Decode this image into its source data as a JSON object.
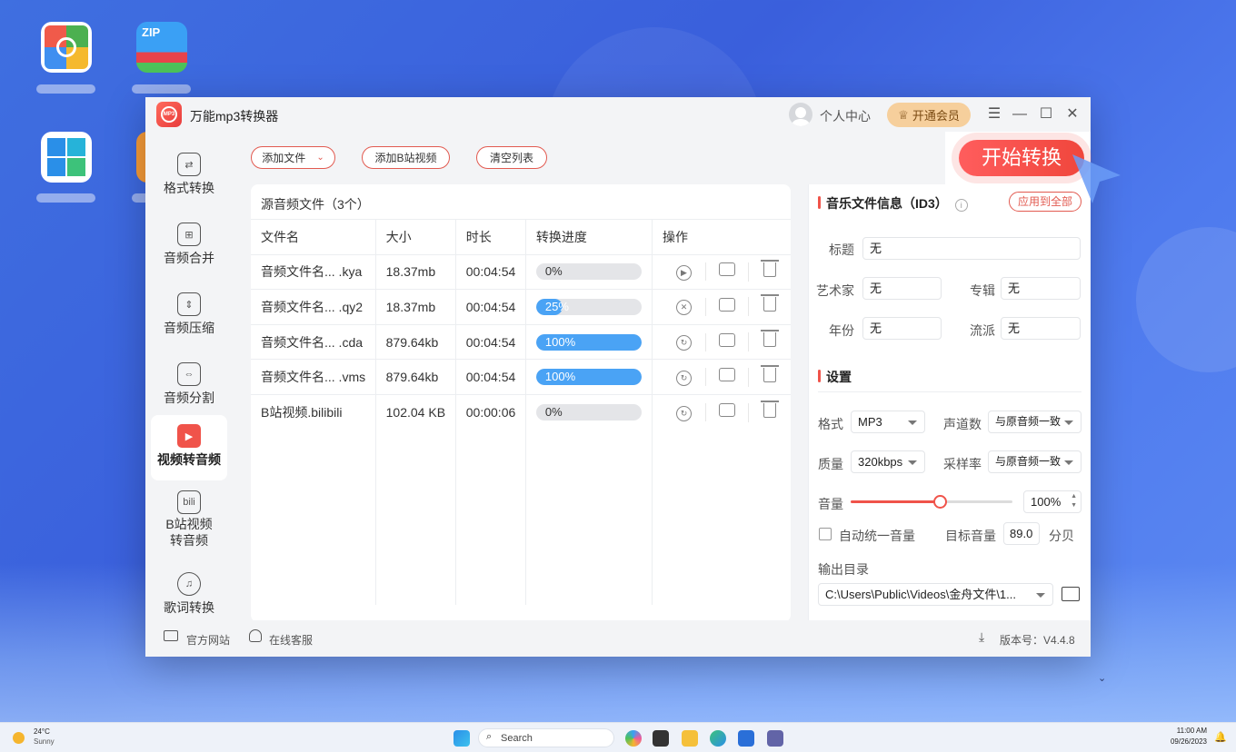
{
  "app": {
    "title": "万能mp3转换器",
    "user_center": "个人中心",
    "vip": "开通会员"
  },
  "window_controls": {
    "menu": "☰",
    "min": "—",
    "max": "☐",
    "close": "✕"
  },
  "sidebar": {
    "items": [
      {
        "label": "格式转换",
        "icon": "format-icon"
      },
      {
        "label": "音频合并",
        "icon": "merge-icon"
      },
      {
        "label": "音频压缩",
        "icon": "compress-icon"
      },
      {
        "label": "音频分割",
        "icon": "split-icon"
      },
      {
        "label": "视频转音频",
        "icon": "video-icon"
      },
      {
        "label": "B站视频转音频",
        "icon": "bilibili-icon"
      },
      {
        "label": "歌词转换",
        "icon": "lyrics-icon"
      }
    ]
  },
  "toolbar": {
    "add_file": "添加文件",
    "add_bilibili": "添加B站视频",
    "clear": "清空列表",
    "start": "开始转换"
  },
  "list": {
    "heading": "源音频文件（3个）",
    "columns": [
      "文件名",
      "大小",
      "时长",
      "转换进度",
      "操作"
    ],
    "rows": [
      {
        "name": "音频文件名... .kya",
        "size": "18.37mb",
        "duration": "00:04:54",
        "progress": 0,
        "progress_text": "0%",
        "action": "play"
      },
      {
        "name": "音频文件名... .qy2",
        "size": "18.37mb",
        "duration": "00:04:54",
        "progress": 25,
        "progress_text": "25%",
        "action": "cancel"
      },
      {
        "name": "音频文件名... .cda",
        "size": "879.64kb",
        "duration": "00:04:54",
        "progress": 100,
        "progress_text": "100%",
        "action": "redo"
      },
      {
        "name": "音频文件名... .vms",
        "size": "879.64kb",
        "duration": "00:04:54",
        "progress": 100,
        "progress_text": "100%",
        "action": "redo"
      },
      {
        "name": "B站视频.bilibili",
        "size": "102.04 KB",
        "duration": "00:00:06",
        "progress": 0,
        "progress_text": "0%",
        "action": "redo"
      }
    ]
  },
  "id3": {
    "title": "音乐文件信息（ID3）",
    "apply_all": "应用到全部",
    "title_label": "标题",
    "title_value": "无",
    "artist_label": "艺术家",
    "artist_value": "无",
    "album_label": "专辑",
    "album_value": "无",
    "year_label": "年份",
    "year_value": "无",
    "genre_label": "流派",
    "genre_value": "无"
  },
  "settings": {
    "title": "设置",
    "format_label": "格式",
    "format_value": "MP3",
    "channels_label": "声道数",
    "channels_value": "与原音频一致",
    "quality_label": "质量",
    "quality_value": "320kbps",
    "samplerate_label": "采样率",
    "samplerate_value": "与原音频一致",
    "volume_label": "音量",
    "volume_value": "100%",
    "volume_level": 0.55,
    "auto_volume_label": "自动统一音量",
    "target_label": "目标音量",
    "target_value": "89.0",
    "target_unit": "分贝",
    "output_label": "输出目录",
    "output_value": "C:\\Users\\Public\\Videos\\金舟文件\\1..."
  },
  "footer": {
    "website": "官方网站",
    "support": "在线客服",
    "version": "版本号：V4.4.8"
  },
  "taskbar": {
    "temp": "24°C",
    "weather": "Sunny",
    "search": "Search",
    "time": "11:00 AM",
    "date": "09/26/2023"
  },
  "colors": {
    "accent": "#f0534a",
    "progress": "#4aa3f5",
    "vip": "#f6cf9c"
  }
}
